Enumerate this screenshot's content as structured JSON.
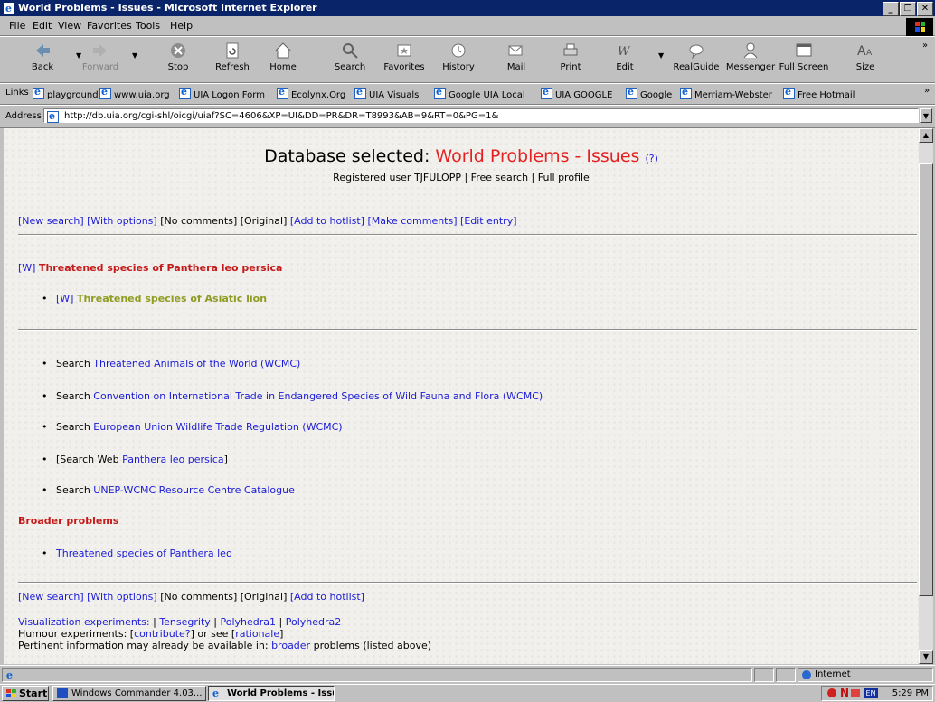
{
  "window": {
    "title": "World Problems - Issues - Microsoft Internet Explorer",
    "controls": [
      "_",
      "&",
      "×"
    ]
  },
  "menu": [
    "File",
    "Edit",
    "View",
    "Favorites",
    "Tools",
    "Help"
  ],
  "toolbar": [
    "Back",
    "Forward",
    "Stop",
    "Refresh",
    "Home",
    "Search",
    "Favorites",
    "History",
    "Mail",
    "Print",
    "Edit",
    "RealGuide",
    "Messenger",
    "Full Screen",
    "Size"
  ],
  "links": {
    "label": "Links",
    "items": [
      "playground",
      "www.uia.org",
      "UIA Logon Form",
      "Ecolynx.Org",
      "UIA Visuals",
      "Google UIA Local",
      "UIA GOOGLE",
      "Google",
      "Merriam-Webster",
      "Free Hotmail"
    ]
  },
  "address": {
    "label": "Address",
    "url": "http://db.uia.org/cgi-shl/oicgi/uiaf?SC=4606&XP=UI&DD=PR&DR=T8993&AB=9&RT=0&PG=1&"
  },
  "page": {
    "db_prefix": "Database selected: ",
    "db_name": "World Problems - Issues",
    "help": "(?)",
    "user_line": {
      "prefix": "Registered user TJFULOPP",
      "sep1": " | ",
      "free_search": "Free search",
      "sep2": " | ",
      "full_profile": "Full profile"
    },
    "nav_top": [
      {
        "text": "[New search]",
        "link": true
      },
      {
        "text": "[With options]",
        "link": true
      },
      {
        "text": "[No comments]",
        "link": false
      },
      {
        "text": "[Original]",
        "link": false
      },
      {
        "text": "[Add to hotlist]",
        "link": true
      },
      {
        "text": "[Make comments]",
        "link": true
      },
      {
        "text": "[Edit entry]",
        "link": true
      }
    ],
    "main": {
      "w_marker": "[W]",
      "title": "Threatened species of Panthera leo persica"
    },
    "sub": {
      "w_marker": "[W]",
      "title": "Threatened species of Asiatic lion"
    },
    "searches": [
      {
        "prefix": "Search ",
        "link": "Threatened Animals of the World (WCMC)",
        "suffix": ""
      },
      {
        "prefix": "Search ",
        "link": "Convention on International Trade in Endangered Species of Wild Fauna and Flora (WCMC)",
        "suffix": ""
      },
      {
        "prefix": "Search ",
        "link": "European Union Wildlife Trade Regulation (WCMC)",
        "suffix": ""
      },
      {
        "prefix": "[Search Web ",
        "link": "Panthera leo persica",
        "suffix": "]"
      },
      {
        "prefix": "Search ",
        "link": "UNEP-WCMC Resource Centre Catalogue",
        "suffix": ""
      }
    ],
    "broader_heading": "Broader problems",
    "broader_items": [
      "Threatened species of Panthera leo"
    ],
    "nav_bottom": [
      {
        "text": "[New search]",
        "link": true
      },
      {
        "text": "[With options]",
        "link": true
      },
      {
        "text": "[No comments]",
        "link": false
      },
      {
        "text": "[Original]",
        "link": false
      },
      {
        "text": "[Add to hotlist]",
        "link": true
      }
    ],
    "viz": {
      "label": "Visualization experiments:",
      "items": [
        "Tensegrity",
        "Polyhedra1",
        "Polyhedra2"
      ],
      "sep": " | "
    },
    "humour": {
      "prefix": "Humour experiments: [",
      "contribute": "contribute?",
      "mid": "] or see [",
      "rationale": "rationale",
      "suffix": "]"
    },
    "pertinent": {
      "prefix": "Pertinent information may already be available in: ",
      "link": "broader",
      "suffix": " problems (listed above)"
    }
  },
  "status": {
    "zone": "Internet"
  },
  "taskbar": {
    "start": "Start",
    "tasks": [
      "Windows Commander 4.03...",
      "World Problems - Issu..."
    ],
    "clock": "5:29 PM"
  }
}
